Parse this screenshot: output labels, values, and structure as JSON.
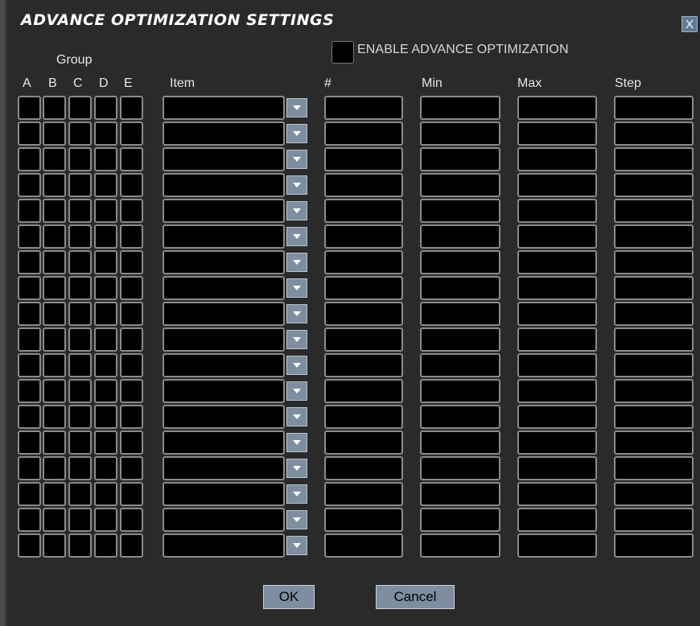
{
  "dialog": {
    "title": "ADVANCE OPTIMIZATION SETTINGS",
    "close_label": "X",
    "enable_label": "ENABLE ADVANCE OPTIMIZATION",
    "enable_checked": false
  },
  "headers": {
    "group": "Group",
    "group_columns": [
      "A",
      "B",
      "C",
      "D",
      "E"
    ],
    "item": "Item",
    "number": "#",
    "min": "Min",
    "max": "Max",
    "step": "Step"
  },
  "rows": [
    {
      "item": "",
      "number": "",
      "min": "",
      "max": "",
      "step": ""
    },
    {
      "item": "",
      "number": "",
      "min": "",
      "max": "",
      "step": ""
    },
    {
      "item": "",
      "number": "",
      "min": "",
      "max": "",
      "step": ""
    },
    {
      "item": "",
      "number": "",
      "min": "",
      "max": "",
      "step": ""
    },
    {
      "item": "",
      "number": "",
      "min": "",
      "max": "",
      "step": ""
    },
    {
      "item": "",
      "number": "",
      "min": "",
      "max": "",
      "step": ""
    },
    {
      "item": "",
      "number": "",
      "min": "",
      "max": "",
      "step": ""
    },
    {
      "item": "",
      "number": "",
      "min": "",
      "max": "",
      "step": ""
    },
    {
      "item": "",
      "number": "",
      "min": "",
      "max": "",
      "step": ""
    },
    {
      "item": "",
      "number": "",
      "min": "",
      "max": "",
      "step": ""
    },
    {
      "item": "",
      "number": "",
      "min": "",
      "max": "",
      "step": ""
    },
    {
      "item": "",
      "number": "",
      "min": "",
      "max": "",
      "step": ""
    },
    {
      "item": "",
      "number": "",
      "min": "",
      "max": "",
      "step": ""
    },
    {
      "item": "",
      "number": "",
      "min": "",
      "max": "",
      "step": ""
    },
    {
      "item": "",
      "number": "",
      "min": "",
      "max": "",
      "step": ""
    },
    {
      "item": "",
      "number": "",
      "min": "",
      "max": "",
      "step": ""
    },
    {
      "item": "",
      "number": "",
      "min": "",
      "max": "",
      "step": ""
    },
    {
      "item": "",
      "number": "",
      "min": "",
      "max": "",
      "step": ""
    }
  ],
  "buttons": {
    "ok": "OK",
    "cancel": "Cancel"
  },
  "icons": {
    "close": "close-icon",
    "dropdown": "chevron-down-icon"
  },
  "colors": {
    "background": "#2a2a2a",
    "field": "#000000",
    "field_border": "#8a8a8a",
    "button": "#7d8ea0"
  }
}
